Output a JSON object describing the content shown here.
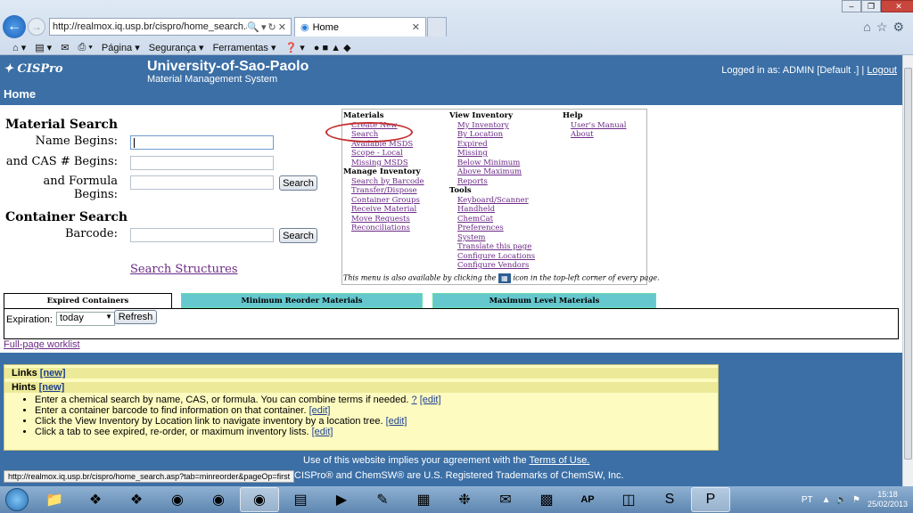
{
  "browser": {
    "url": "http://realmox.iq.usp.br/cispro/home_search.as",
    "tab_title": "Home",
    "menu_bar": [
      "Página",
      "Segurança",
      "Ferramentas"
    ]
  },
  "header": {
    "logo": "CISPro",
    "org": "University-of-Sao-Paolo",
    "subtitle": "Material Management System",
    "login_text": "Logged in as: ADMIN [Default .] |",
    "logout": "Logout",
    "page_name": "Home"
  },
  "material_search": {
    "title": "Material Search",
    "name_label": "Name Begins:",
    "cas_label": "and CAS # Begins:",
    "formula_label": "and Formula Begins:",
    "search_button": "Search"
  },
  "container_search": {
    "title": "Container Search",
    "barcode_label": "Barcode:",
    "search_button": "Search"
  },
  "search_structures": "Search Structures",
  "menu": {
    "materials_header": "Materials",
    "materials": [
      "Create New",
      "Search",
      "Available MSDS",
      "Scope - Local",
      "Missing MSDS"
    ],
    "manage_header": "Manage Inventory",
    "manage": [
      "Search by Barcode",
      "Transfer/Dispose",
      "Container Groups",
      "Receive Material",
      "Move Requests",
      "Reconciliations"
    ],
    "view_header": "View Inventory",
    "view": [
      "My Inventory",
      "By Location",
      "Expired",
      "Missing",
      "Below Minimum",
      "Above Maximum",
      "Reports"
    ],
    "tools_header": "Tools",
    "tools": [
      "Keyboard/Scanner",
      "Handheld",
      "ChemCat",
      "Preferences",
      "System",
      "Translate this page",
      "Configure Locations",
      "Configure Vendors"
    ],
    "help_header": "Help",
    "help": [
      "User's Manual",
      "About"
    ],
    "note_before": "This menu is also available by clicking the",
    "note_after": "icon in the top-left corner of every page."
  },
  "worklist": {
    "tabs": [
      "Expired Containers",
      "Minimum Reorder Materials",
      "Maximum Level Materials"
    ],
    "expiration_label": "Expiration:",
    "expiration_value": "today",
    "refresh_button": "Refresh",
    "full_page_link": "Full-page worklist"
  },
  "links_box": {
    "links_label": "Links",
    "links_new": "[new]",
    "hints_label": "Hints",
    "hints_new": "[new]",
    "hints": [
      {
        "text": "Enter a chemical search by name, CAS, or formula. You can combine terms if needed.",
        "extra": "?",
        "edit": "[edit]"
      },
      {
        "text": "Enter a container barcode to find information on that container.",
        "extra": "",
        "edit": "[edit]"
      },
      {
        "text": "Click the View Inventory by Location link to navigate inventory by a location tree.",
        "extra": "",
        "edit": "[edit]"
      },
      {
        "text": "Click a tab to see expired, re-order, or maximum inventory lists.",
        "extra": "",
        "edit": "[edit]"
      }
    ]
  },
  "footer": {
    "terms_before": "Use of this website implies your agreement with the",
    "terms_link": "Terms of Use.",
    "trademark": "CISPro® and ChemSW® are U.S. Registered Trademarks of ChemSW, Inc."
  },
  "status_url": "http://realmox.iq.usp.br/cispro/home_search.asp?tab=minreorder&pageOp=first",
  "taskbar": {
    "language": "PT",
    "time": "15:18",
    "date": "25/02/2013"
  },
  "colors": {
    "header_bg": "#3b6fa6",
    "tab_teal": "#66c8cf",
    "hints_bg": "#fdfbc0",
    "link_purple": "#6b2a86",
    "annotation_red": "#c43030"
  }
}
